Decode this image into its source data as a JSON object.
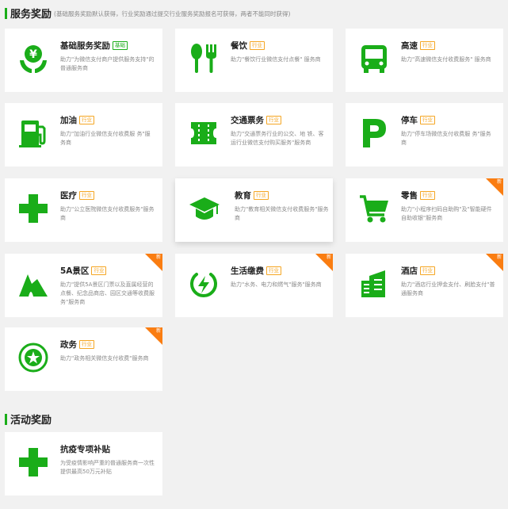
{
  "colors": {
    "accent": "#1aad19",
    "tag_orange": "#f5a623",
    "ribbon": "#fa7d11"
  },
  "service_section": {
    "title": "服务奖励",
    "note": "(基础服务奖励默认获得，行业奖励通过提交行业服务奖励报名可获得，两者不能同时获得)"
  },
  "activity_section": {
    "title": "活动奖励"
  },
  "cards": [
    {
      "name": "基础服务奖励",
      "tag": "基础",
      "desc": "助力\"为微信支付商户提供服务支持\"的普通服务商",
      "icon": "yuan-hands-icon"
    },
    {
      "name": "餐饮",
      "tag": "行业",
      "desc": "助力\"餐饮行业微信支付点餐\" 服务商",
      "icon": "fork-spoon-icon"
    },
    {
      "name": "高速",
      "tag": "行业",
      "desc": "助力\"高速微信支付收费服务\" 服务商",
      "icon": "bus-icon"
    },
    {
      "name": "加油",
      "tag": "行业",
      "desc": "助力\"加油行业微信支付收费服 务\"服务商",
      "icon": "fuel-pump-icon"
    },
    {
      "name": "交通票务",
      "tag": "行业",
      "desc": "助力\"交通票务行业的公交、地 铁、客运行业微信支付购买服务\"服务商",
      "icon": "ticket-icon"
    },
    {
      "name": "停车",
      "tag": "行业",
      "desc": "助力\"停车场微信支付收费服 务\"服务商",
      "icon": "parking-icon"
    },
    {
      "name": "医疗",
      "tag": "行业",
      "desc": "助力\"公立医院微信支付收费服务\"服务商",
      "icon": "medical-cross-icon"
    },
    {
      "name": "教育",
      "tag": "行业",
      "desc": "助力\"教育相关微信支付收费服务\"服务商",
      "icon": "graduation-cap-icon"
    },
    {
      "name": "零售",
      "tag": "行业",
      "desc": "助力\"小程序扫码自助购\"及\"智能硬件自助收银\"服务商",
      "icon": "shopping-cart-icon",
      "ribbon": "新"
    },
    {
      "name": "5A景区",
      "tag": "行业",
      "desc": "助力\"提供5A景区门票以及直属经营的点餐、纪念品商店、园区交通等收费服务\"服务商",
      "icon": "mountain-icon",
      "ribbon": "新"
    },
    {
      "name": "生活缴费",
      "tag": "行业",
      "desc": "助力\"水务、电力和燃气\"服务\"服务商",
      "icon": "power-icon",
      "ribbon": "新"
    },
    {
      "name": "酒店",
      "tag": "行业",
      "desc": "助力\"酒店行业押金支付、刷脸支付\"普通服务商",
      "icon": "hotel-building-icon",
      "ribbon": "新"
    },
    {
      "name": "政务",
      "tag": "行业",
      "desc": "助力\"政务相关微信支付收费\"服务商",
      "icon": "emblem-icon",
      "ribbon": "新"
    }
  ],
  "activity_card": {
    "name": "抗疫专项补贴",
    "desc": "为受疫情影响严重的普通服务商一次性提供最高50万元补贴",
    "icon": "medical-cross-icon"
  }
}
